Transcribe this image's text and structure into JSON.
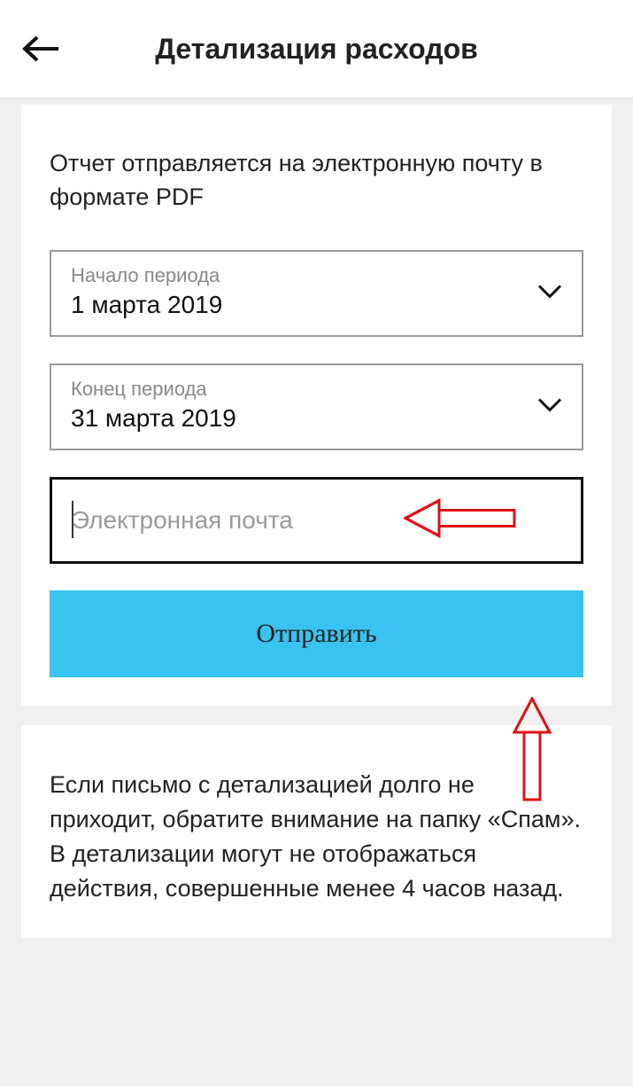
{
  "header": {
    "title": "Детализация расходов"
  },
  "form": {
    "description": "Отчет отправляется на электронную почту в формате PDF",
    "start": {
      "label": "Начало периода",
      "value": "1 марта 2019"
    },
    "end": {
      "label": "Конец периода",
      "value": "31 марта 2019"
    },
    "email": {
      "placeholder": "Электронная почта",
      "value": ""
    },
    "submit_label": "Отправить"
  },
  "note": {
    "text": "Если письмо с детализацией долго не приходит, обратите внимание на папку «Спам». В детализации могут не отображаться действия, совершенные менее 4 часов назад."
  }
}
